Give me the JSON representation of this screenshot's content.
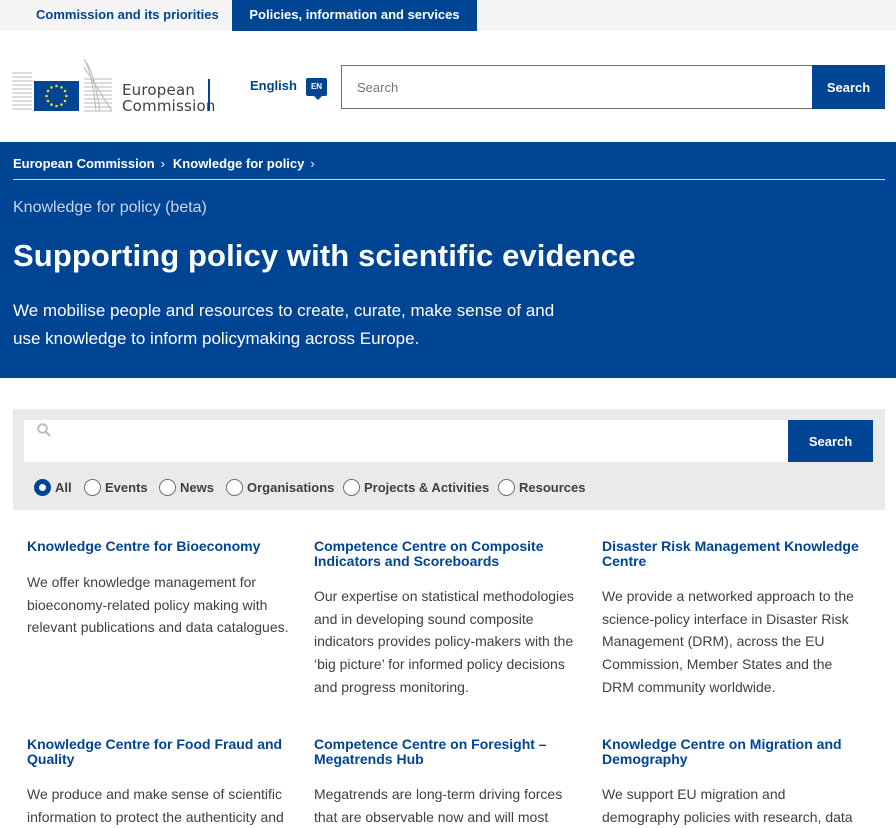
{
  "top_nav": {
    "tab1": "Commission and its priorities",
    "tab2": "Policies, information and services"
  },
  "header": {
    "logo_text_line1": "European",
    "logo_text_line2": "Commission",
    "language": "English",
    "language_code": "EN",
    "search_placeholder": "Search",
    "search_button": "Search"
  },
  "hero": {
    "breadcrumb": [
      "European Commission",
      "Knowledge for policy"
    ],
    "kicker": "Knowledge for policy (beta)",
    "title": "Supporting policy with scientific evidence",
    "description_line1": "We mobilise people and resources to create, curate, make sense of and",
    "description_line2": "use knowledge to inform policymaking across Europe."
  },
  "search_panel": {
    "search_value": "",
    "search_button": "Search",
    "filters": [
      {
        "label": "All",
        "selected": true
      },
      {
        "label": "Events",
        "selected": false
      },
      {
        "label": "News",
        "selected": false
      },
      {
        "label": "Organisations",
        "selected": false
      },
      {
        "label": "Projects & Activities",
        "selected": false
      },
      {
        "label": "Resources",
        "selected": false
      }
    ]
  },
  "cards": [
    {
      "title": "Knowledge Centre for Bioeconomy",
      "text": "We offer knowledge management for bioeconomy-related policy making with relevant publications and data catalogues."
    },
    {
      "title": "Competence Centre on Composite Indicators and Scoreboards",
      "text": "Our expertise on statistical methodologies and in developing sound composite indicators provides policy-makers with the ‘big picture’ for informed policy decisions and progress monitoring."
    },
    {
      "title": "Disaster Risk Management Knowledge Centre",
      "text": "We provide a networked approach to the science-policy interface in Disaster Risk Management (DRM), across the EU Commission, Member States and the DRM community worldwide."
    },
    {
      "title": "Knowledge Centre for Food Fraud and Quality",
      "text": "We produce and make sense of scientific information to protect the authenticity and"
    },
    {
      "title": "Competence Centre on Foresight – Megatrends Hub",
      "text": "Megatrends are long-term driving forces that are observable now and will most"
    },
    {
      "title": "Knowledge Centre on Migration and Demography",
      "text": "We support EU migration and demography policies with research, data"
    }
  ],
  "colors": {
    "brand_blue": "#004494",
    "eu_yellow": "#ffd617"
  }
}
